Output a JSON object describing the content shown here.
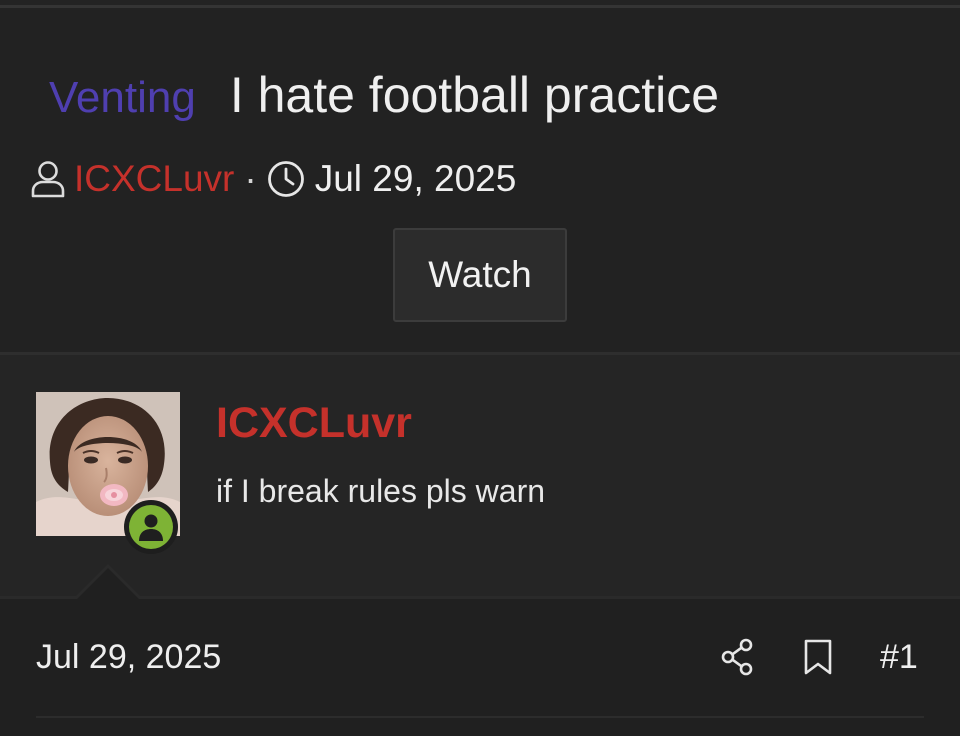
{
  "thread": {
    "prefix": "Venting",
    "title": "I hate football practice",
    "author": "ICXCLuvr",
    "separator": "·",
    "date": "Jul 29, 2025",
    "watch_label": "Watch"
  },
  "post": {
    "username": "ICXCLuvr",
    "user_title": "if I break rules pls warn",
    "date": "Jul 29, 2025",
    "number": "#1",
    "online": true
  },
  "colors": {
    "prefix": "#4f3fb0",
    "username": "#c5312b",
    "online_badge": "#7eb335",
    "background": "#232323"
  },
  "icons": {
    "author": "user-icon",
    "date": "clock-icon",
    "share": "share-icon",
    "bookmark": "bookmark-icon",
    "online": "online-status-icon"
  }
}
